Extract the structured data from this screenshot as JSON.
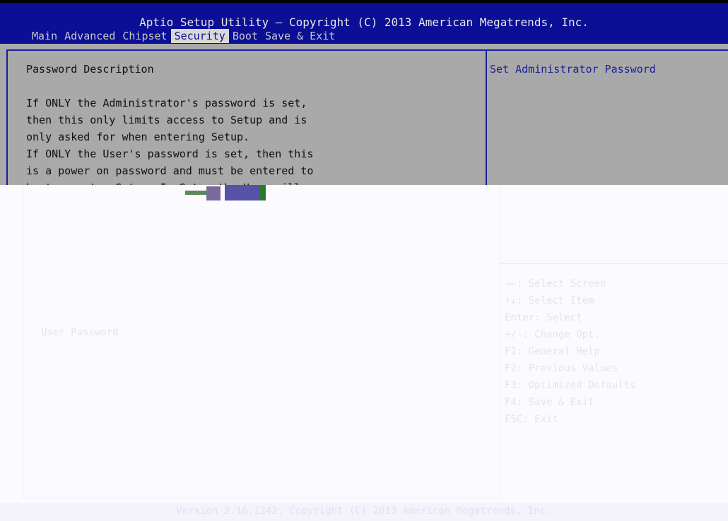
{
  "header": {
    "title": "Aptio Setup Utility – Copyright (C) 2013 American Megatrends, Inc.",
    "tabs": [
      {
        "label": "Main",
        "active": false
      },
      {
        "label": "Advanced",
        "active": false
      },
      {
        "label": "Chipset",
        "active": false
      },
      {
        "label": "Security",
        "active": true
      },
      {
        "label": "Boot",
        "active": false
      },
      {
        "label": "Save & Exit",
        "active": false
      }
    ]
  },
  "main": {
    "description_title": "Password Description",
    "description_lines": [
      "If ONLY the Administrator's password is set,",
      "then this only limits access to Setup and is",
      "only asked for when entering Setup.",
      "If ONLY the User's password is set, then this",
      "is a power on password and must be entered to",
      "boot or enter Setup. In Setup the User will"
    ],
    "user_password_label": "User Password"
  },
  "help": {
    "text": "Set Administrator Password",
    "keys": [
      "→←: Select Screen",
      "↑↓: Select Item",
      "Enter: Select",
      "+/-: Change Opt.",
      "F1: General Help",
      "F2: Previous Values",
      "F3: Optimized Defaults",
      "F4: Save & Exit",
      "ESC: Exit"
    ]
  },
  "footer": {
    "text": "Version 2.16.1242. Copyright (C) 2013 American Megatrends, Inc."
  },
  "colors": {
    "header_bg": "#0a0f95",
    "panel_bg": "#a9a9a9",
    "accent_blue": "#1a1f9a"
  }
}
